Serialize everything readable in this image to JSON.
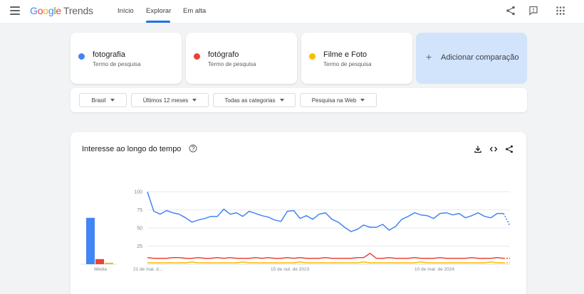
{
  "header": {
    "logo_google": "Google",
    "logo_product": "Trends",
    "nav": [
      "Início",
      "Explorar",
      "Em alta"
    ]
  },
  "terms": [
    {
      "name": "fotografia",
      "type": "Termo de pesquisa",
      "color": "#4285f4"
    },
    {
      "name": "fotógrafo",
      "type": "Termo de pesquisa",
      "color": "#ea4335"
    },
    {
      "name": "Filme e Foto",
      "type": "Termo de pesquisa",
      "color": "#fbbc04"
    }
  ],
  "add_comparison": "Adicionar comparação",
  "filters": {
    "region": "Brasil",
    "period": "Últimos 12 meses",
    "category": "Todas as categorias",
    "search_type": "Pesquisa na Web"
  },
  "interest_card": {
    "title": "Interesse ao longo do tempo"
  },
  "chart_data": {
    "type": "line",
    "y_ticks": [
      "100",
      "75",
      "50",
      "25"
    ],
    "ylim": [
      0,
      100
    ],
    "x_tick_labels": [
      "21 de mai. d...",
      "15 de out. de 2023",
      "10 de mar. de 2024"
    ],
    "average_label": "Média",
    "averages": [
      64,
      7,
      2
    ],
    "partial_last_point": true,
    "series": [
      {
        "name": "fotografia",
        "color": "#4285f4",
        "values": [
          100,
          73,
          69,
          74,
          71,
          69,
          64,
          58,
          61,
          63,
          66,
          66,
          76,
          69,
          71,
          66,
          73,
          70,
          67,
          65,
          61,
          59,
          73,
          74,
          63,
          67,
          62,
          69,
          71,
          62,
          58,
          51,
          45,
          48,
          54,
          51,
          51,
          55,
          47,
          52,
          62,
          66,
          71,
          68,
          67,
          63,
          70,
          71,
          68,
          70,
          64,
          67,
          71,
          66,
          64,
          70,
          70,
          53
        ]
      },
      {
        "name": "fotógrafo",
        "color": "#ea4335",
        "values": [
          9,
          8,
          8,
          8,
          9,
          9,
          8,
          8,
          9,
          8,
          8,
          9,
          8,
          9,
          8,
          8,
          8,
          9,
          8,
          9,
          8,
          8,
          9,
          8,
          9,
          8,
          8,
          8,
          9,
          8,
          8,
          8,
          8,
          9,
          9,
          15,
          8,
          8,
          9,
          8,
          8,
          8,
          9,
          8,
          8,
          8,
          9,
          8,
          8,
          8,
          8,
          9,
          8,
          8,
          8,
          9,
          8,
          8
        ]
      },
      {
        "name": "Filme e Foto",
        "color": "#fbbc04",
        "values": [
          2,
          2,
          2,
          2,
          2,
          2,
          2,
          3,
          2,
          2,
          2,
          2,
          2,
          2,
          2,
          3,
          2,
          2,
          2,
          2,
          2,
          2,
          2,
          2,
          3,
          2,
          2,
          2,
          2,
          2,
          2,
          2,
          2,
          2,
          3,
          2,
          2,
          2,
          2,
          2,
          2,
          2,
          2,
          3,
          2,
          2,
          2,
          2,
          2,
          2,
          2,
          2,
          2,
          2,
          3,
          2,
          2,
          2
        ]
      }
    ]
  }
}
